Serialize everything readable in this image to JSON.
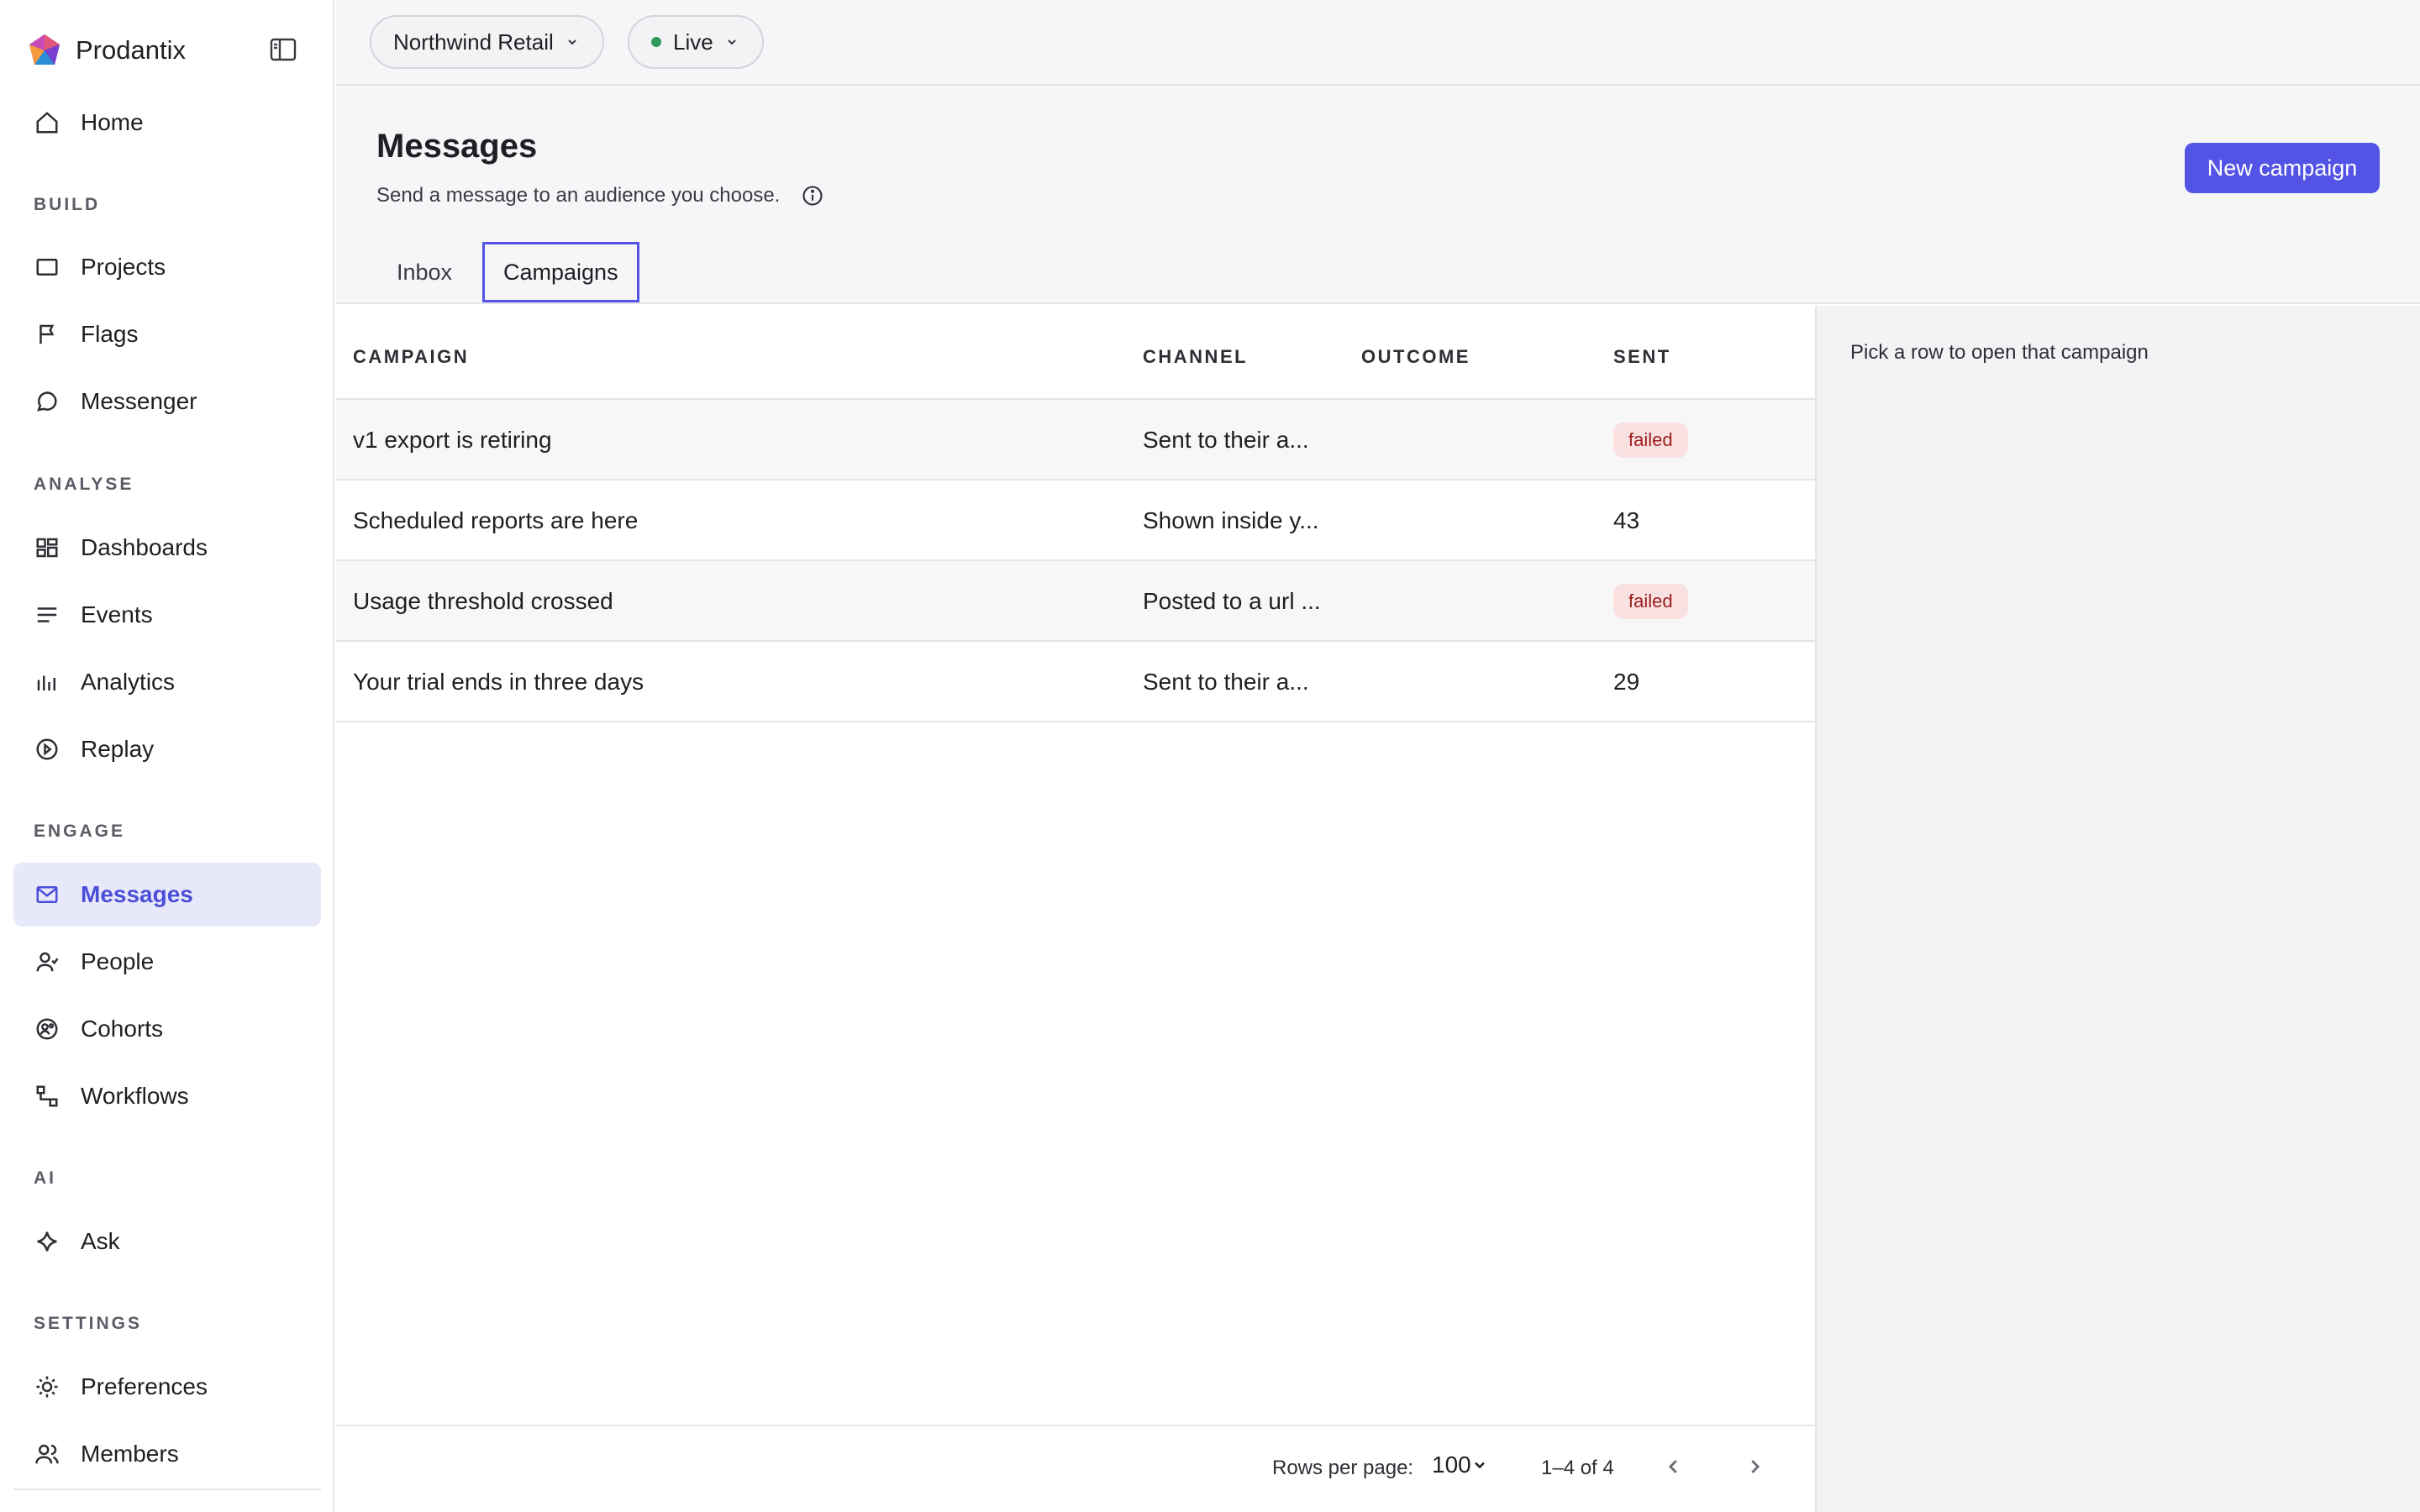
{
  "brand": {
    "name": "Prodantix"
  },
  "sidebar": {
    "home": "Home",
    "sections": {
      "build": "BUILD",
      "analyse": "ANALYSE",
      "engage": "ENGAGE",
      "ai": "AI",
      "settings": "SETTINGS"
    },
    "items": {
      "projects": "Projects",
      "flags": "Flags",
      "messenger": "Messenger",
      "dashboards": "Dashboards",
      "events": "Events",
      "analytics": "Analytics",
      "replay": "Replay",
      "messages": "Messages",
      "people": "People",
      "cohorts": "Cohorts",
      "workflows": "Workflows",
      "ask": "Ask",
      "preferences": "Preferences",
      "members": "Members"
    }
  },
  "topbar": {
    "workspace": "Northwind Retail",
    "environment": "Live"
  },
  "header": {
    "title": "Messages",
    "subtitle": "Send a message to an audience you choose.",
    "new_button": "New campaign",
    "tabs": [
      "Inbox",
      "Campaigns"
    ],
    "active_tab": "Campaigns"
  },
  "table": {
    "columns": [
      "CAMPAIGN",
      "CHANNEL",
      "OUTCOME",
      "SENT"
    ],
    "rows": [
      {
        "campaign": "v1 export is retiring",
        "channel": "Sent to their a...",
        "outcome": "",
        "sent": "failed",
        "sent_is_badge": true
      },
      {
        "campaign": "Scheduled reports are here",
        "channel": "Shown inside y...",
        "outcome": "",
        "sent": "43",
        "sent_is_badge": false
      },
      {
        "campaign": "Usage threshold crossed",
        "channel": "Posted to a url ...",
        "outcome": "",
        "sent": "failed",
        "sent_is_badge": true
      },
      {
        "campaign": "Your trial ends in three days",
        "channel": "Sent to their a...",
        "outcome": "",
        "sent": "29",
        "sent_is_badge": false
      }
    ],
    "footer": {
      "rows_per_page_label": "Rows per page:",
      "rows_per_page": "100",
      "range": "1–4 of 4"
    }
  },
  "detail": {
    "empty_text": "Pick a row to open that campaign"
  },
  "colors": {
    "accent": "#5353e6",
    "active_nav_bg": "#e8e8fb",
    "failed_badge_bg": "#fae1e1",
    "failed_badge_text": "#9a1c1c",
    "live_dot": "#2e9a5d"
  }
}
